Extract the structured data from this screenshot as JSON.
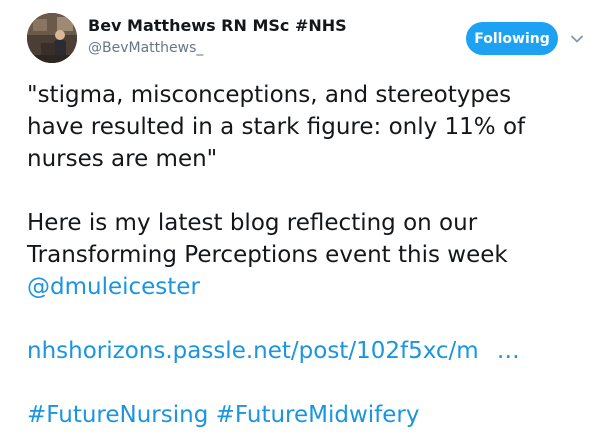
{
  "author": {
    "name": "Bev Matthews RN MSc #NHS",
    "handle": "@BevMatthews_"
  },
  "follow_button": {
    "label": "Following",
    "color": "#1da1f2"
  },
  "tweet": {
    "quote_line1": "\"stigma, misconceptions, and stereotypes",
    "quote_line2": "have resulted in a stark figure: only 11% of",
    "quote_line3": "nurses are men\"",
    "body_line1": "Here is my latest blog reflecting on our",
    "body_line2": "Transforming Perceptions event this week",
    "mention": "@dmuleicester",
    "url_text": "nhshorizons.passle.net/post/102f5xc/m",
    "url_ellipsis": "…",
    "hashtag1": "#FutureNursing",
    "hashtag2": "#FutureMidwifery"
  },
  "icons": {
    "menu": "chevron-down-icon",
    "avatar": "profile-photo"
  },
  "colors": {
    "link": "#1b95e0",
    "text": "#14171a",
    "muted": "#657786"
  }
}
